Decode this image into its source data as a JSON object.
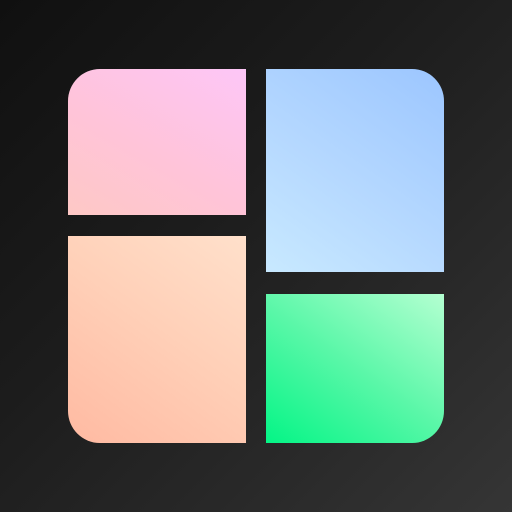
{
  "icon": {
    "name": "four-tile-collage-app-icon",
    "background_colors": [
      "#101010",
      "#353535"
    ],
    "tiles": [
      {
        "name": "tile-top-left",
        "colors": [
          "#fec8c5",
          "#fdc6f7"
        ]
      },
      {
        "name": "tile-bottom-left",
        "colors": [
          "#ffbaa2",
          "#ffe0cb"
        ]
      },
      {
        "name": "tile-top-right",
        "colors": [
          "#c8e9ff",
          "#9cc6ff"
        ]
      },
      {
        "name": "tile-bottom-right",
        "colors": [
          "#04f586",
          "#b4ffd1"
        ]
      }
    ]
  }
}
